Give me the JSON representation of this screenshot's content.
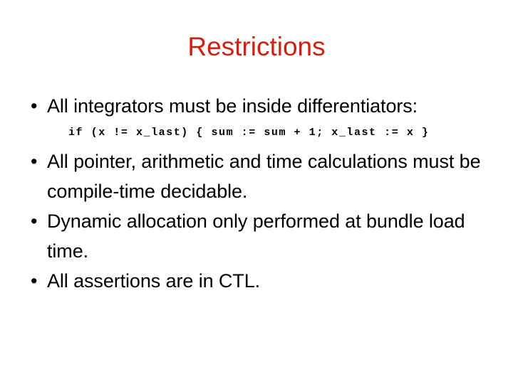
{
  "slide": {
    "title": "Restrictions",
    "title_color": "#cc2211",
    "background_color": "#ffffff",
    "text_color": "#000000",
    "bullet_marker": "•",
    "bullets": [
      {
        "text": "All integrators must be inside differentiators:",
        "code": "if (x != x_last) { sum := sum + 1; x_last := x }"
      },
      {
        "text": "All pointer, arithmetic and time calculations must be compile-time decidable."
      },
      {
        "text": "Dynamic allocation only performed at bundle load time."
      },
      {
        "text": "All assertions are in CTL."
      }
    ]
  }
}
